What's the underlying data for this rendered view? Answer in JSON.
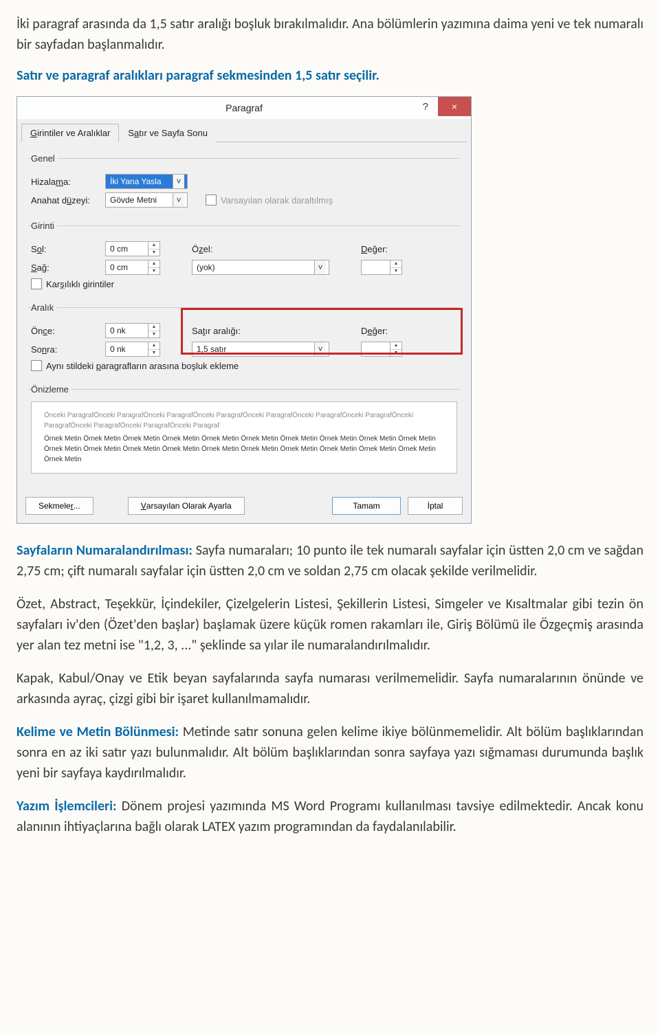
{
  "intro": "İki paragraf arasında da 1,5 satır aralığı boşluk bırakılmalıdır. Ana bölümlerin yazımına daima yeni ve tek numaralı bir sayfadan başlanmalıdır.",
  "blue_heading": "Satır ve paragraf aralıkları paragraf sekmesinden 1,5 satır seçilir.",
  "dialog": {
    "title": "Paragraf",
    "help": "?",
    "close": "×",
    "tabs": {
      "active": "Girintiler ve Aralıklar",
      "other": "Satır ve Sayfa Sonu"
    },
    "genel": {
      "legend": "Genel",
      "hizalama_label": "Hizalama:",
      "hizalama_value": "İki Yana Yasla",
      "anahat_label": "Anahat düzeyi:",
      "anahat_value": "Gövde Metni",
      "collapsed_label": "Varsayılan olarak daraltılmış"
    },
    "girinti": {
      "legend": "Girinti",
      "sol_label": "Sol:",
      "sol_value": "0 cm",
      "sag_label": "Sağ:",
      "sag_value": "0 cm",
      "ozel_label": "Özel:",
      "ozel_value": "(yok)",
      "deger_label": "Değer:",
      "mirror_label": "Karşılıklı girintiler"
    },
    "aralik": {
      "legend": "Aralık",
      "once_label": "Önce:",
      "once_value": "0 nk",
      "sonra_label": "Sonra:",
      "sonra_value": "0 nk",
      "spacing_label": "Satır aralığı:",
      "spacing_value": "1,5 satır",
      "deger_label": "Değer:",
      "nospace_label": "Aynı stildeki paragrafların arasına boşluk ekleme"
    },
    "onizleme": {
      "legend": "Önizleme",
      "ghost": "Önceki ParagrafÖnceki ParagrafÖnceki ParagrafÖnceki ParagrafÖnceki ParagrafÖnceki ParagrafÖnceki ParagrafÖnceki ParagrafÖnceki ParagrafÖnceki ParagrafÖnceki Paragraf",
      "sample": "Örnek Metin Örnek Metin Örnek Metin Örnek Metin Örnek Metin Örnek Metin Örnek Metin Örnek Metin Örnek Metin Örnek Metin Örnek Metin Örnek Metin Örnek Metin Örnek Metin Örnek Metin Örnek Metin Örnek Metin Örnek Metin Örnek Metin Örnek Metin Örnek Metin"
    },
    "buttons": {
      "tabs": "Sekmeler...",
      "defaults": "Varsayılan Olarak Ayarla",
      "ok": "Tamam",
      "cancel": "İptal"
    }
  },
  "para_pagenum_label": "Sayfaların Numaralandırılması:",
  "para_pagenum": " Sayfa numaraları; 10 punto ile tek numaralı sayfalar için üstten 2,0 cm ve sağdan 2,75 cm; çift numaralı sayfalar için üstten 2,0 cm ve soldan 2,75 cm olacak şekilde verilmelidir.",
  "para_roman": "Özet, Abstract, Teşekkür, İçindekiler, Çizelgelerin Listesi, Şekillerin Listesi, Simgeler ve Kısaltmalar gibi tezin ön sayfaları iv'den (Özet'den başlar) başlamak üzere küçük romen rakamları ile, Giriş Bölümü ile Özgeçmiş arasında yer alan tez metni ise \"1,2, 3, ...\" şeklinde sa yılar ile numaralandırılmalıdır.",
  "para_cover": "Kapak, Kabul/Onay ve Etik beyan sayfalarında sayfa numarası verilmemelidir. Sayfa numaralarının önünde ve arkasında ayraç, çizgi gibi bir işaret kullanılmamalıdır.",
  "para_word_label": "Kelime ve Metin Bölünmesi:",
  "para_word": " Metinde satır sonuna gelen kelime ikiye bölünmemelidir. Alt bölüm başlıklarından sonra en az iki satır yazı bulunmalıdır. Alt bölüm başlıklarından sonra sayfaya yazı sığmaması durumunda başlık yeni bir sayfaya kaydırılmalıdır.",
  "para_proc_label": "Yazım İşlemcileri:",
  "para_proc": " Dönem projesi yazımında MS Word Programı kullanılması tavsiye edilmektedir. Ancak konu alanının ihtiyaçlarına bağlı olarak LATEX yazım programından da faydalanılabilir."
}
